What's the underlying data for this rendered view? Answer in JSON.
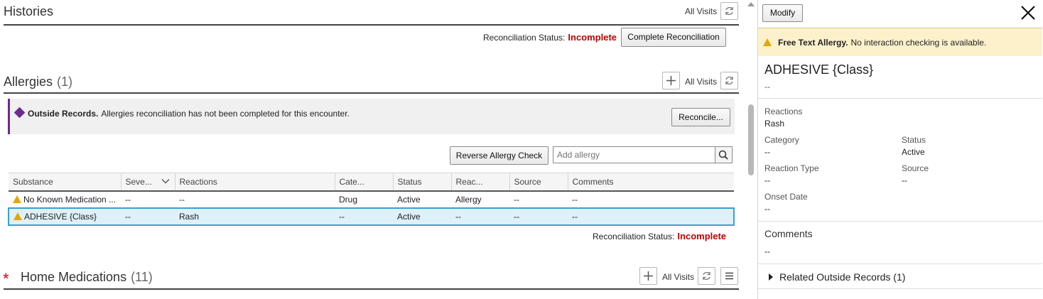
{
  "histories": {
    "title": "Histories",
    "all_visits": "All Visits",
    "reconciliation_label": "Reconciliation Status:",
    "reconciliation_value": "Incomplete",
    "complete_button": "Complete Reconciliation"
  },
  "allergies": {
    "title": "Allergies",
    "count": "(1)",
    "all_visits": "All Visits",
    "banner_bold": "Outside Records.",
    "banner_text": "Allergies reconciliation has not been completed for this encounter.",
    "reconcile_button": "Reconcile...",
    "reverse_check_button": "Reverse Allergy Check",
    "search_placeholder": "Add allergy",
    "columns": [
      "Substance",
      "Seve...",
      "Reactions",
      "Cate...",
      "Status",
      "Reac...",
      "Source",
      "Comments"
    ],
    "rows": [
      {
        "substance": "No Known Medication ...",
        "severity": "--",
        "reactions": "--",
        "category": "Drug",
        "status": "Active",
        "reaction_type": "Allergy",
        "source": "--",
        "comments": "--"
      },
      {
        "substance": "ADHESIVE {Class}",
        "severity": "--",
        "reactions": "Rash",
        "category": "--",
        "status": "Active",
        "reaction_type": "--",
        "source": "--",
        "comments": "--"
      }
    ],
    "reconciliation_label": "Reconciliation Status:",
    "reconciliation_value": "Incomplete"
  },
  "home_medications": {
    "required_mark": "*",
    "title": "Home Medications",
    "count": "(11)",
    "all_visits": "All Visits"
  },
  "detail": {
    "modify_button": "Modify",
    "alert_bold": "Free Text Allergy.",
    "alert_text": "No interaction checking is available.",
    "title": "ADHESIVE {Class}",
    "subtitle": "--",
    "reactions_label": "Reactions",
    "reactions_value": "Rash",
    "category_label": "Category",
    "category_value": "--",
    "status_label": "Status",
    "status_value": "Active",
    "reaction_type_label": "Reaction Type",
    "reaction_type_value": "--",
    "source_label": "Source",
    "source_value": "--",
    "onset_label": "Onset Date",
    "onset_value": "--",
    "comments_label": "Comments",
    "comments_value": "--",
    "related_label": "Related Outside Records (1)"
  },
  "colors": {
    "incomplete": "#c00000",
    "outside_records": "#6e2a8c",
    "alert_bg": "#fdf1cc",
    "selection": "#3a9fd1"
  },
  "icons": [
    "refresh-icon",
    "plus-icon",
    "search-icon",
    "menu-icon",
    "warning-icon",
    "close-icon",
    "diamond-icon",
    "chevron-down-icon",
    "triangle-right-icon"
  ]
}
